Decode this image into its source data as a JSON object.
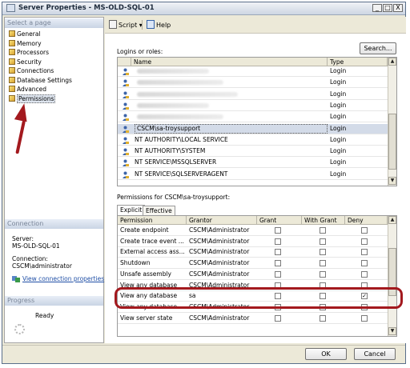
{
  "window": {
    "title": "Server Properties - MS-OLD-SQL-01",
    "controls": [
      "_",
      "□",
      "X"
    ]
  },
  "left_pane": {
    "select_page_header": "Select a page",
    "pages": [
      "General",
      "Memory",
      "Processors",
      "Security",
      "Connections",
      "Database Settings",
      "Advanced",
      "Permissions"
    ],
    "selected_page": "Permissions",
    "connection": {
      "header": "Connection",
      "server_label": "Server:",
      "server_value": "MS-OLD-SQL-01",
      "connection_label": "Connection:",
      "connection_value": "CSCM\\administrator",
      "view_link": "View connection properties"
    },
    "progress": {
      "header": "Progress",
      "status": "Ready"
    }
  },
  "toolbar": {
    "script_label": "Script",
    "help_label": "Help"
  },
  "logins": {
    "label": "Logins or roles:",
    "search_button": "Search...",
    "columns": [
      "Name",
      "Type"
    ],
    "rows": [
      {
        "name": "",
        "type": "Login",
        "obscured": true
      },
      {
        "name": "",
        "type": "Login",
        "obscured": true
      },
      {
        "name": "",
        "type": "Login",
        "obscured": true
      },
      {
        "name": "",
        "type": "Login",
        "obscured": true
      },
      {
        "name": "",
        "type": "Login",
        "obscured": true
      },
      {
        "name": "CSCM\\sa-troysupport",
        "type": "Login",
        "selected": true
      },
      {
        "name": "NT AUTHORITY\\LOCAL SERVICE",
        "type": "Login"
      },
      {
        "name": "NT AUTHORITY\\SYSTEM",
        "type": "Login"
      },
      {
        "name": "NT SERVICE\\MSSQLSERVER",
        "type": "Login"
      },
      {
        "name": "NT SERVICE\\SQLSERVERAGENT",
        "type": "Login"
      }
    ]
  },
  "permissions": {
    "label": "Permissions for CSCM\\sa-troysupport:",
    "tabs": [
      "Explicit",
      "Effective"
    ],
    "active_tab": "Explicit",
    "columns": [
      "Permission",
      "Grantor",
      "Grant",
      "With Grant",
      "Deny"
    ],
    "rows": [
      {
        "permission": "Create endpoint",
        "grantor": "CSCM\\Administrator",
        "grant": false,
        "with_grant": false,
        "deny": false
      },
      {
        "permission": "Create trace event ...",
        "grantor": "CSCM\\Administrator",
        "grant": false,
        "with_grant": false,
        "deny": false
      },
      {
        "permission": "External access ass...",
        "grantor": "CSCM\\Administrator",
        "grant": false,
        "with_grant": false,
        "deny": false
      },
      {
        "permission": "Shutdown",
        "grantor": "CSCM\\Administrator",
        "grant": false,
        "with_grant": false,
        "deny": false
      },
      {
        "permission": "Unsafe assembly",
        "grantor": "CSCM\\Administrator",
        "grant": false,
        "with_grant": false,
        "deny": false
      },
      {
        "permission": "View any database",
        "grantor": "CSCM\\Administrator",
        "grant": false,
        "with_grant": false,
        "deny": false
      },
      {
        "permission": "View any database",
        "grantor": "sa",
        "grant": false,
        "with_grant": false,
        "deny": true
      },
      {
        "permission": "View any database",
        "grantor": "CSCM\\Administrator",
        "grant": false,
        "with_grant": false,
        "deny": false
      },
      {
        "permission": "View server state",
        "grantor": "CSCM\\Administrator",
        "grant": false,
        "with_grant": false,
        "deny": false
      }
    ]
  },
  "footer": {
    "ok_label": "OK",
    "cancel_label": "Cancel"
  },
  "colors": {
    "annotation": "#a3191e",
    "selected_row": "#d3dbe8",
    "link": "#1f4fa6"
  }
}
